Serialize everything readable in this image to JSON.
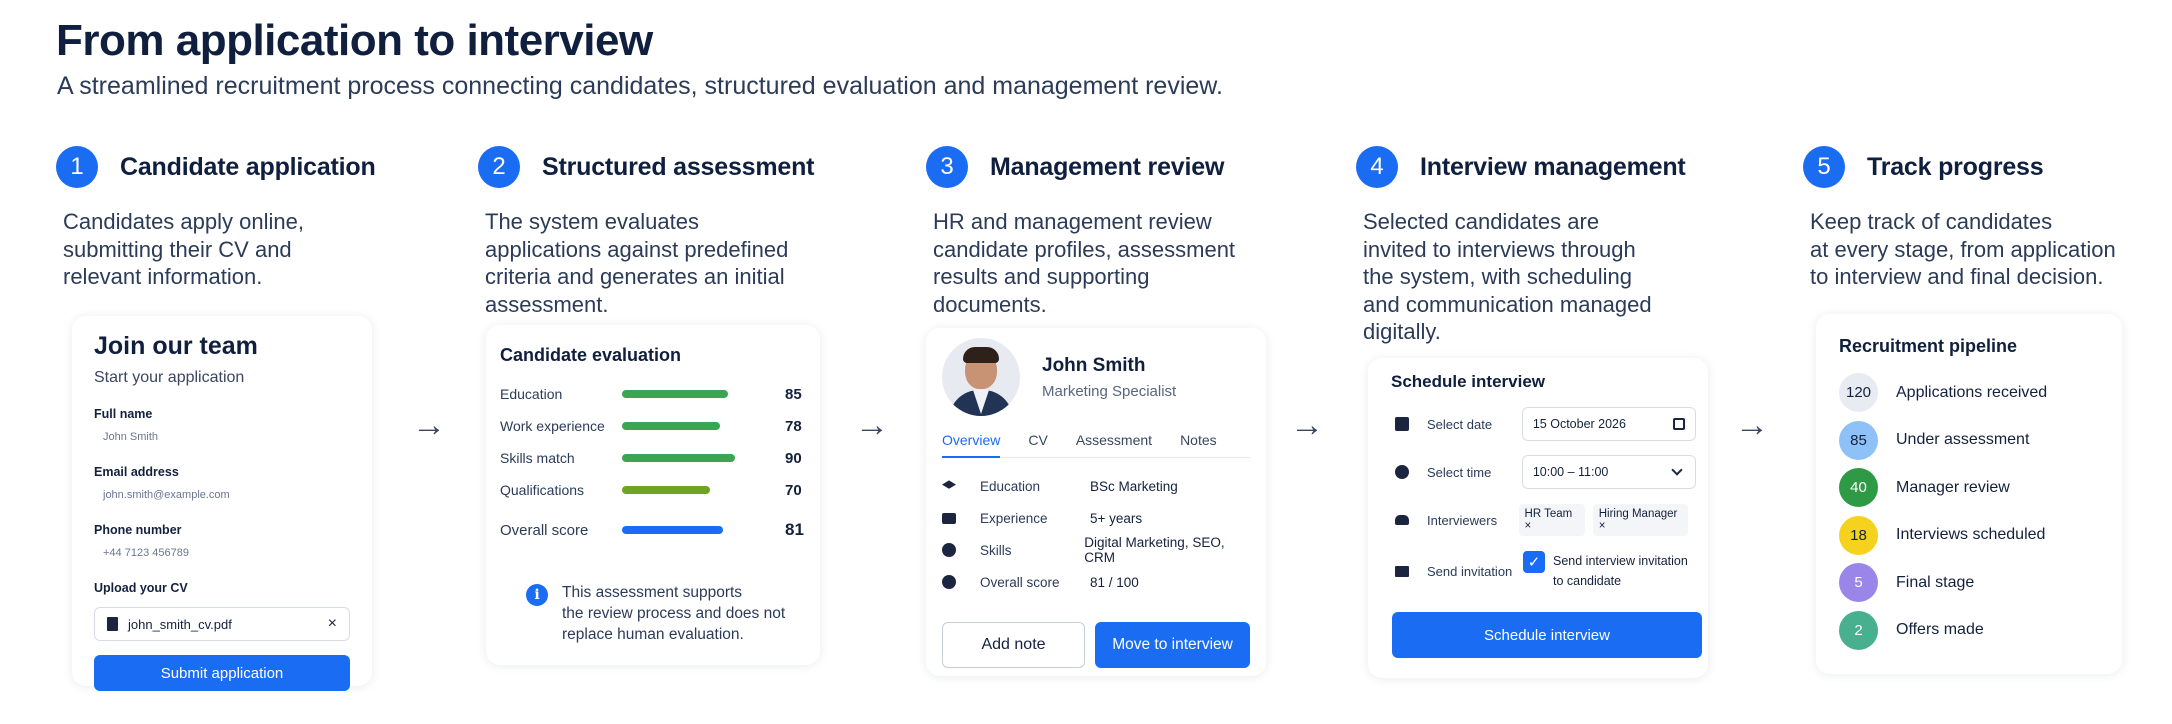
{
  "header": {
    "title": "From application to interview",
    "subtitle": "A streamlined recruitment process connecting candidates, structured evaluation and management review."
  },
  "steps": [
    {
      "number": "1",
      "title": "Candidate application",
      "description": [
        "Candidates apply online,",
        "submitting their CV and",
        "relevant information."
      ]
    },
    {
      "number": "2",
      "title": "Structured assessment",
      "description": [
        "The system evaluates",
        "applications against predefined",
        "criteria and generates an initial",
        "assessment."
      ]
    },
    {
      "number": "3",
      "title": "Management review",
      "description": [
        "HR and management review",
        "candidate profiles, assessment",
        "results and supporting",
        "documents."
      ]
    },
    {
      "number": "4",
      "title": "Interview management",
      "description": [
        "Selected candidates are",
        "invited to interviews through",
        "the system, with scheduling",
        "and communication managed",
        "digitally."
      ]
    },
    {
      "number": "5",
      "title": "Track progress",
      "description": [
        "Keep track of candidates",
        "at every stage, from application",
        "to interview and final decision."
      ]
    }
  ],
  "arrow_glyph": "→",
  "application_form": {
    "title": "Join our team",
    "subtitle": "Start your application",
    "fields": [
      {
        "label": "Full name",
        "value": "John Smith"
      },
      {
        "label": "Email address",
        "value": "john.smith@example.com"
      },
      {
        "label": "Phone number",
        "value": "+44 7123 456789"
      }
    ],
    "upload_label": "Upload your CV",
    "file_name": "john_smith_cv.pdf",
    "file_icon": "document-icon",
    "remove_glyph": "×",
    "submit_label": "Submit application"
  },
  "evaluation": {
    "title": "Candidate evaluation",
    "criteria": [
      {
        "label": "Education",
        "value": 85,
        "color": "#3aa552"
      },
      {
        "label": "Work experience",
        "value": 78,
        "color": "#3aa552"
      },
      {
        "label": "Skills match",
        "value": 90,
        "color": "#3aa552"
      },
      {
        "label": "Qualifications",
        "value": 70,
        "color": "#6fa51e"
      },
      {
        "label": "Overall score",
        "value": 81,
        "color": "#1a6cf2"
      }
    ],
    "info_icon": "info-icon",
    "info_glyph": "i",
    "info_lines": [
      "This assessment supports",
      "the review process and does not",
      "replace human evaluation."
    ]
  },
  "profile": {
    "name": "John Smith",
    "role": "Marketing Specialist",
    "tabs": [
      "Overview",
      "CV",
      "Assessment",
      "Notes"
    ],
    "active_tab": "Overview",
    "rows": [
      {
        "icon": "graduation-cap-icon",
        "label": "Education",
        "value": "BSc Marketing"
      },
      {
        "icon": "briefcase-icon",
        "label": "Experience",
        "value": "5+ years"
      },
      {
        "icon": "badge-check-icon",
        "label": "Skills",
        "value": "Digital Marketing, SEO, CRM"
      },
      {
        "icon": "alert-circle-icon",
        "label": "Overall score",
        "value": "81 / 100"
      }
    ],
    "add_note_label": "Add note",
    "move_label": "Move to interview"
  },
  "schedule": {
    "title": "Schedule interview",
    "date_label": "Select date",
    "date_value": "15 October 2026",
    "time_label": "Select time",
    "time_value": "10:00 – 11:00",
    "interviewers_label": "Interviewers",
    "interviewers": [
      "HR Team ×",
      "Hiring Manager ×"
    ],
    "invitation_label": "Send invitation",
    "invitation_text": [
      "Send interview invitation",
      "to candidate"
    ],
    "check_glyph": "✓",
    "button_label": "Schedule interview",
    "accent": "#1a6cf2"
  },
  "pipeline": {
    "title": "Recruitment pipeline",
    "stages": [
      {
        "count": "120",
        "label": "Applications received",
        "bg": "#e8ebf1",
        "fg": "#14213d"
      },
      {
        "count": "85",
        "label": "Under assessment",
        "bg": "#8ec1f7",
        "fg": "#14213d"
      },
      {
        "count": "40",
        "label": "Manager review",
        "bg": "#2f9a46",
        "fg": "#ffffff"
      },
      {
        "count": "18",
        "label": "Interviews scheduled",
        "bg": "#f4d21e",
        "fg": "#14213d"
      },
      {
        "count": "5",
        "label": "Final stage",
        "bg": "#9a86e8",
        "fg": "#ffffff"
      },
      {
        "count": "2",
        "label": "Offers made",
        "bg": "#48b08f",
        "fg": "#ffffff"
      }
    ]
  }
}
